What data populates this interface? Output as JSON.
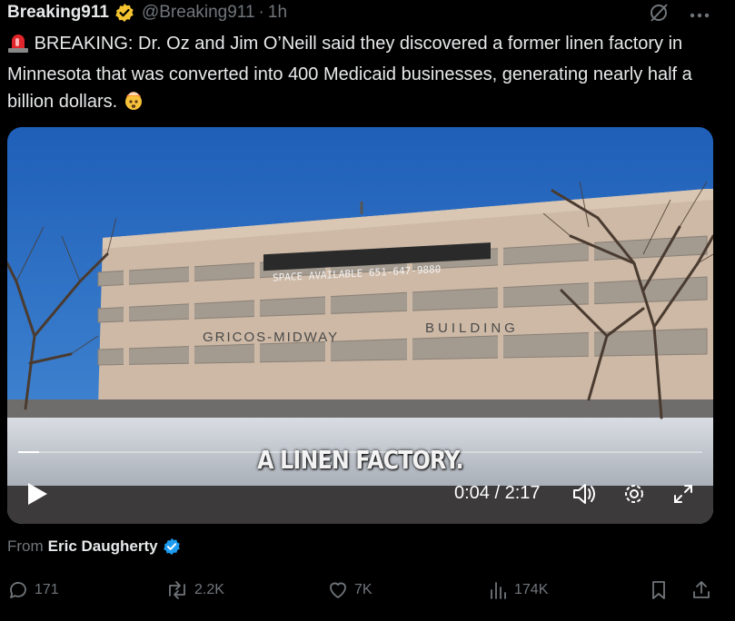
{
  "tweet": {
    "author_name": "Breaking911",
    "handle": "@Breaking911",
    "separator": "·",
    "time": "1h",
    "text": "BREAKING: Dr. Oz and Jim O’Neill said they discovered a former linen factory in Minnesota that was converted into 400 Medicaid businesses, generating nearly half a billion dollars.",
    "icons": [
      "siren-emoji",
      "exploding-head-emoji",
      "verified-badge-icon",
      "grok-icon",
      "more-icon"
    ]
  },
  "video": {
    "caption": "A LINEN FACTORY.",
    "sign_space": "SPACE AVAILABLE 651-647-9880",
    "sign_building_left": "GRICOS-MIDWAY",
    "sign_building_right": "BUILDING",
    "current_time": "0:04",
    "time_separator": " / ",
    "duration": "2:17",
    "progress_percent": 3,
    "controls": [
      "play-icon",
      "volume-icon",
      "settings-icon",
      "fullscreen-icon"
    ]
  },
  "attribution": {
    "prefix": "From",
    "name": "Eric Daugherty"
  },
  "actions": {
    "replies": "171",
    "reposts": "2.2K",
    "likes": "7K",
    "views": "174K",
    "icons": [
      "reply-icon",
      "repost-icon",
      "like-icon",
      "views-icon",
      "bookmark-icon",
      "share-icon"
    ]
  },
  "colors": {
    "background": "#000000",
    "text": "#e7e9ea",
    "muted": "#71767b",
    "verified_gold": "#f4c430",
    "verified_blue": "#1d9bf0"
  }
}
